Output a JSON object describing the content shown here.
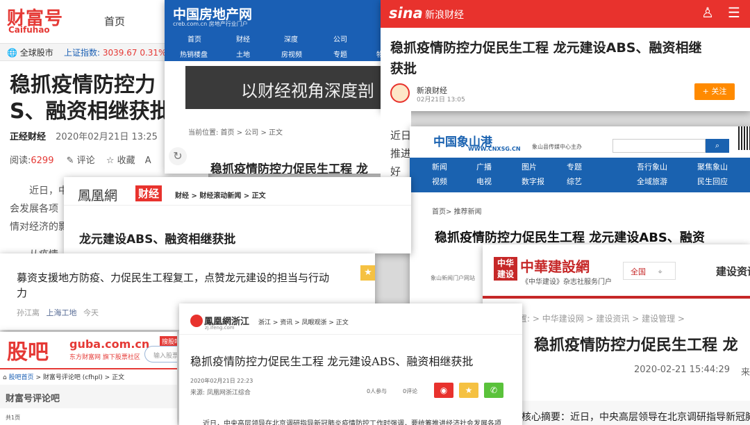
{
  "card1": {
    "logo": "财富号",
    "logo_sub": "Caifuhao",
    "nav_home": "首页",
    "market_label": "全球股市",
    "index_label": "上证指数:",
    "index_value": "3039.67",
    "index_change": "0.31%",
    "index_arrow": "↑",
    "title": "稳抓疫情防控力促民生工程 龙元建设ABS、融资相继获批",
    "title_line1": "稳抓疫情防控力",
    "title_line2": "S、融资相继获批",
    "source": "正经财经",
    "time": "2020年02月21日 13:25",
    "read_label": "阅读:",
    "read_count": "6299",
    "comment_label": "评论",
    "favorite_label": "收藏",
    "letter": "A",
    "body_line1": "近日，中",
    "body_line2": "会发展各项",
    "body_line3": "情对经济的影",
    "body_line4": "从疫情"
  },
  "card2": {
    "logo": "中国房地产网",
    "logo_sub": "creb.com.cn 房地产行业门户",
    "nav_row1": [
      "首页",
      "财经",
      "深度",
      "公司"
    ],
    "nav_row2": [
      "热销楼盘",
      "土地",
      "房视频",
      "专题",
      "物"
    ],
    "banner": "以财经视角深度剖",
    "breadcrumb": "当前位置: 首页 > 公司 > 正文",
    "title": "稳抓疫情防控力促民生工程 龙"
  },
  "card3": {
    "logo": "sina",
    "channel": "新浪财经",
    "title_line1": "稳抓疫情防控力促民生工程 龙元建设ABS、融资相继",
    "title_line2": "获批",
    "author": "新浪财经",
    "time": "02月21日 13:05",
    "follow_label": "+ 关注",
    "body_line1": "近日",
    "body_line2": "推进",
    "body_line3": "好"
  },
  "card4": {
    "logo": "中国象山港",
    "logo_url": "WWW.CNXSG.CN",
    "logo_note": "象山县传媒中心主办",
    "nav_col1": [
      "新闻",
      "视频"
    ],
    "nav_col2": [
      "广播",
      "电视"
    ],
    "nav_col3": [
      "图片",
      "数字报"
    ],
    "nav_col4": [
      "专题",
      "综艺"
    ],
    "nav_col5": [
      "吾行象山",
      "全域旅游"
    ],
    "nav_col6": [
      "聚焦象山",
      "民生回应"
    ],
    "breadcrumb": "首页> 推荐新闻",
    "title": "稳抓疫情防控力促民生工程 龙元建设ABS、融资",
    "source": "象山新闻门户网站"
  },
  "card5": {
    "logo": "鳳凰網",
    "logo_tag": "财经",
    "breadcrumb": "财经 > 财经滚动新闻 > 正文",
    "title": "龙元建设ABS、融资相继获批"
  },
  "card6": {
    "title_line1": "募资支援地方防疫、力促民生工程复工，点赞龙元建设的担当与行动",
    "title_line2": "力",
    "author": "孙江离",
    "source": "上海工地",
    "time": "今天"
  },
  "card7": {
    "logo": "股吧",
    "logo_guba": "guba.com.cn",
    "logo_sub": "东方财富网 旗下股票社区",
    "hot_tag": "搜股吧",
    "search_placeholder": "输入股票",
    "breadcrumb_home": "股吧首页",
    "breadcrumb_rest": "> 财富号评论吧 (cfhpl) > 正文",
    "bar_title": "财富号评论吧",
    "page_label": "共1页"
  },
  "card8": {
    "logo_seal": "中华建设",
    "logo": "中華建設網",
    "logo_sub": "《中华建设》杂志社服务门户",
    "region": "全国",
    "section": "建设资讯",
    "breadcrumb": "置: > 中华建设网 > 建设资讯 > 建设管理 >",
    "title": "稳抓疫情防控力促民生工程 龙",
    "time": "2020-02-21 15:44:29",
    "source_prefix": "来",
    "summary": "核心摘要：近日，中央高层领导在北京调研指导新冠肺"
  },
  "card9": {
    "logo": "鳳凰網浙江",
    "logo_url": "zj.ifeng.com",
    "breadcrumb": "浙江 > 资讯 > 凤眼观浙 > 正文",
    "title": "稳抓疫情防控力促民生工程 龙元建设ABS、融资相继获批",
    "date": "2020年02月21日 22:23",
    "source": "来源: 凤凰网浙江综合",
    "participants": "0人参与",
    "comments": "0评论",
    "body": "近日，中央高层领导在北京调研指导新冠肺炎疫情防控工作时强调，要统筹推进经济社会发展各项"
  }
}
